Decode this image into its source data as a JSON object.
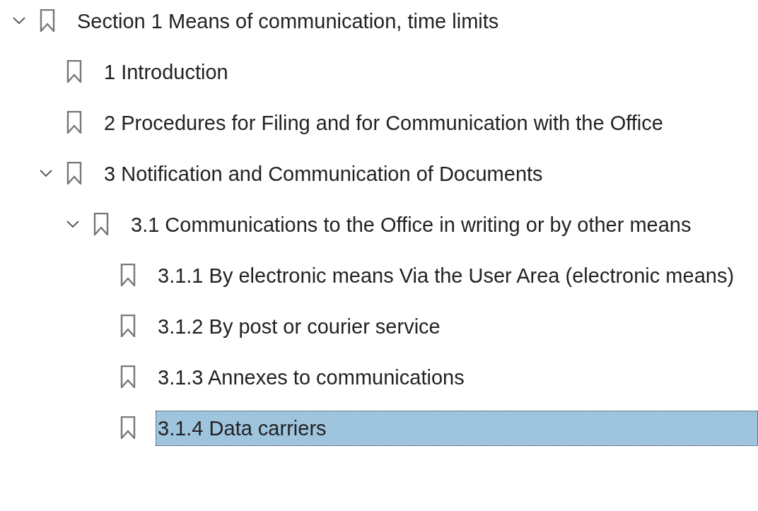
{
  "bookmarks": [
    {
      "label": "Section 1 Means of communication, time limits",
      "expanded": true,
      "selected": false,
      "children": [
        {
          "label": "1 Introduction",
          "selected": false
        },
        {
          "label": "2 Procedures for Filing and for Communication with the Office",
          "selected": false
        },
        {
          "label": "3 Notification and Communication of Documents",
          "expanded": true,
          "selected": false,
          "children": [
            {
              "label": "3.1 Communications to the Office in writing or by other means",
              "expanded": true,
              "selected": false,
              "children": [
                {
                  "label": "3.1.1 By electronic means Via the User Area (electronic means)",
                  "selected": false
                },
                {
                  "label": "3.1.2 By post or courier service",
                  "selected": false
                },
                {
                  "label": "3.1.3 Annexes to communications",
                  "selected": false
                },
                {
                  "label": "3.1.4 Data carriers",
                  "selected": true
                }
              ]
            }
          ]
        }
      ]
    }
  ]
}
